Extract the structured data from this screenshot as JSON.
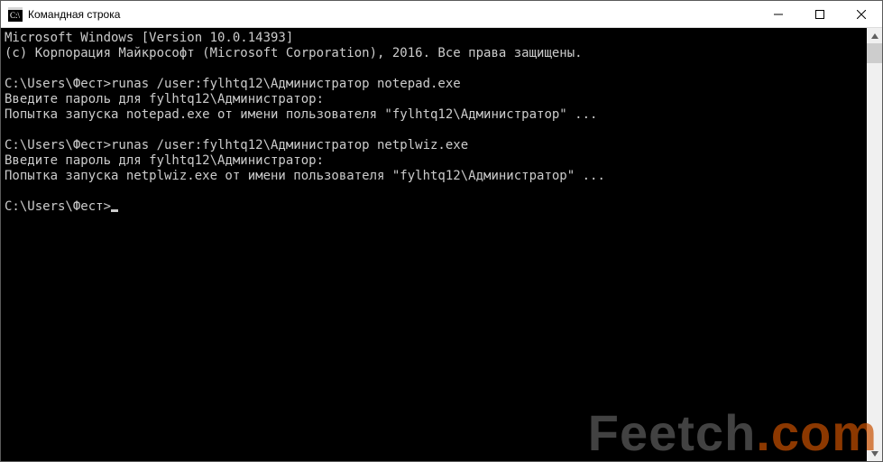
{
  "window": {
    "title": "Командная строка"
  },
  "console": {
    "lines": [
      "Microsoft Windows [Version 10.0.14393]",
      "(c) Корпорация Майкрософт (Microsoft Corporation), 2016. Все права защищены.",
      "",
      "C:\\Users\\Фест>runas /user:fylhtq12\\Администратор notepad.exe",
      "Введите пароль для fylhtq12\\Администратор:",
      "Попытка запуска notepad.exe от имени пользователя \"fylhtq12\\Администратор\" ...",
      "",
      "C:\\Users\\Фест>runas /user:fylhtq12\\Администратор netplwiz.exe",
      "Введите пароль для fylhtq12\\Администратор:",
      "Попытка запуска netplwiz.exe от имени пользователя \"fylhtq12\\Администратор\" ...",
      ""
    ],
    "prompt": "C:\\Users\\Фест>"
  },
  "watermark": {
    "part1": "Feetch",
    "dot": ".",
    "part2": "com"
  }
}
